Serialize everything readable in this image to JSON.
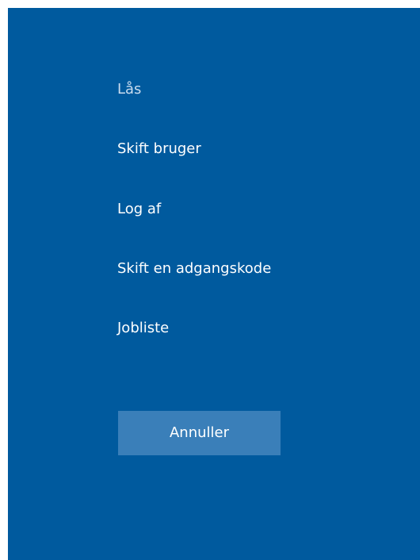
{
  "menu": {
    "items": [
      {
        "label": "Lås"
      },
      {
        "label": "Skift bruger"
      },
      {
        "label": "Log af"
      },
      {
        "label": "Skift en adgangskode"
      },
      {
        "label": "Jobliste"
      }
    ]
  },
  "cancel": {
    "label": "Annuller"
  },
  "colors": {
    "background": "#005a9e",
    "button": "#3a7fb9",
    "text": "#ffffff"
  }
}
